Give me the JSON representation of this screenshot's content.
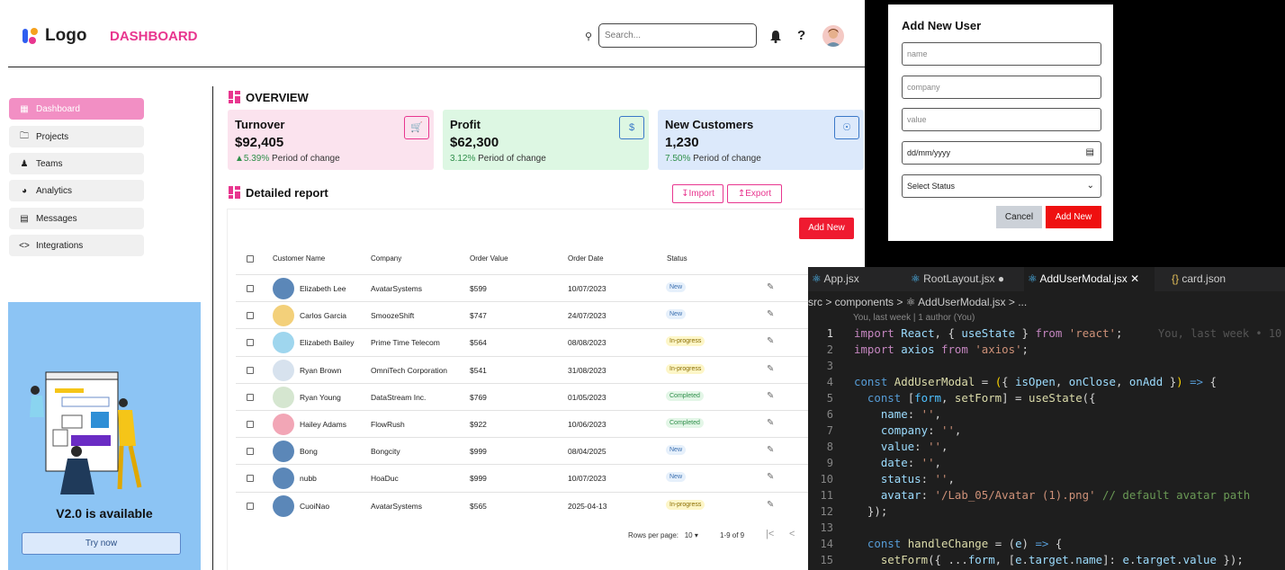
{
  "header": {
    "logo_text": "Logo",
    "page_title": "DASHBOARD",
    "search_placeholder": "Search...",
    "help_label": "?"
  },
  "sidebar": {
    "items": [
      {
        "label": "Dashboard",
        "icon": "grid-icon",
        "active": true
      },
      {
        "label": "Projects",
        "icon": "folder-icon"
      },
      {
        "label": "Teams",
        "icon": "people-icon"
      },
      {
        "label": "Analytics",
        "icon": "chart-icon"
      },
      {
        "label": "Messages",
        "icon": "chat-icon"
      },
      {
        "label": "Integrations",
        "icon": "code-icon"
      }
    ],
    "promo": {
      "title": "V2.0 is available",
      "button": "Try now"
    }
  },
  "overview": {
    "title": "OVERVIEW",
    "cards": [
      {
        "label": "Turnover",
        "value": "$92,405",
        "pct": "▲5.39%",
        "change_text": "Period of change",
        "icon": "cart-icon",
        "bg": "#fbe3ee",
        "accent": "#e8368f"
      },
      {
        "label": "Profit",
        "value": "$62,300",
        "pct": "3.12%",
        "change_text": "Period of change",
        "icon": "dollar-icon",
        "bg": "#ddf7e3",
        "accent": "#3a78c8"
      },
      {
        "label": "New Customers",
        "value": "1,230",
        "pct": "7.50%",
        "change_text": "Period of change",
        "icon": "user-circle-icon",
        "bg": "#dce9fb",
        "accent": "#3a78c8"
      }
    ]
  },
  "report": {
    "title": "Detailed report",
    "import_label": "Import",
    "export_label": "Export",
    "add_new_label": "Add New",
    "columns": [
      "Customer Name",
      "Company",
      "Order Value",
      "Order Date",
      "Status"
    ],
    "rows": [
      {
        "name": "Elizabeth Lee",
        "company": "AvatarSystems",
        "value": "$599",
        "date": "10/07/2023",
        "status": "New",
        "kind": "new",
        "av": "#5b87b8"
      },
      {
        "name": "Carlos Garcia",
        "company": "SmoozeShift",
        "value": "$747",
        "date": "24/07/2023",
        "status": "New",
        "kind": "new",
        "av": "#f3d07a"
      },
      {
        "name": "Elizabeth Bailey",
        "company": "Prime Time Telecom",
        "value": "$564",
        "date": "08/08/2023",
        "status": "In-progress",
        "kind": "prog",
        "av": "#9fd6ee"
      },
      {
        "name": "Ryan Brown",
        "company": "OmniTech Corporation",
        "value": "$541",
        "date": "31/08/2023",
        "status": "In-progress",
        "kind": "prog",
        "av": "#d7e2ee"
      },
      {
        "name": "Ryan Young",
        "company": "DataStream Inc.",
        "value": "$769",
        "date": "01/05/2023",
        "status": "Completed",
        "kind": "done",
        "av": "#d5e6d0"
      },
      {
        "name": "Hailey Adams",
        "company": "FlowRush",
        "value": "$922",
        "date": "10/06/2023",
        "status": "Completed",
        "kind": "done",
        "av": "#f2a6b6"
      },
      {
        "name": "Bong",
        "company": "Bongcity",
        "value": "$999",
        "date": "08/04/2025",
        "status": "New",
        "kind": "new",
        "av": "#5b87b8"
      },
      {
        "name": "nubb",
        "company": "HoaDuc",
        "value": "$999",
        "date": "10/07/2023",
        "status": "New",
        "kind": "new",
        "av": "#5b87b8"
      },
      {
        "name": "CuoiNao",
        "company": "AvatarSystems",
        "value": "$565",
        "date": "2025-04-13",
        "status": "In-progress",
        "kind": "prog",
        "av": "#5b87b8"
      }
    ],
    "pager": {
      "label": "Rows per page:",
      "per_page": "10",
      "count": "1-9 of 9"
    }
  },
  "modal": {
    "title": "Add New User",
    "fields": {
      "name": "name",
      "company": "company",
      "value": "value",
      "date": "dd/mm/yyyy",
      "status": "Select Status"
    },
    "cancel": "Cancel",
    "add": "Add New"
  },
  "editor": {
    "tabs": [
      "App.jsx",
      "RootLayout.jsx",
      "AddUserModal.jsx",
      "card.json"
    ],
    "breadcrumb": "src > components > ⚛ AddUserModal.jsx > ...",
    "blame": "You, last week | 1 author (You)",
    "ghost": "You, last week • 10",
    "line_numbers": [
      "1",
      "2",
      "3",
      "4",
      "5",
      "6",
      "7",
      "8",
      "9",
      "10",
      "11",
      "12",
      "13",
      "14",
      "15"
    ]
  }
}
